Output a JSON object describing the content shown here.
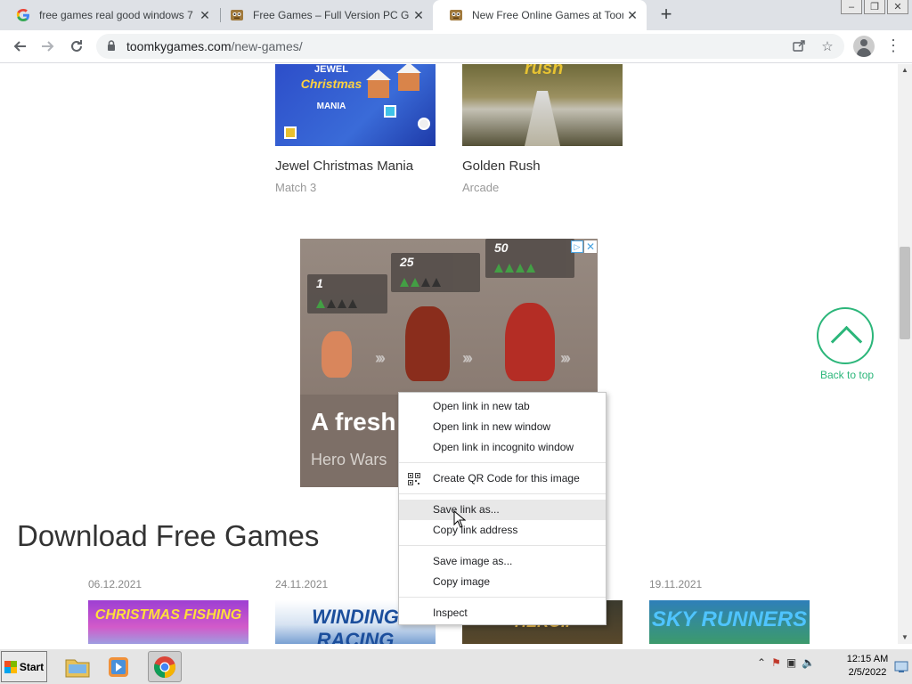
{
  "tabs": [
    {
      "title": "free games real good windows 7",
      "favicon": "google-icon",
      "active": false
    },
    {
      "title": "Free Games – Full Version PC Ga",
      "favicon": "toomky-icon",
      "active": false
    },
    {
      "title": "New Free Online Games at Toom",
      "favicon": "toomky-icon",
      "active": true
    }
  ],
  "address": {
    "domain": "toomkygames.com",
    "path": "/new-games/"
  },
  "games": [
    {
      "name": "Jewel Christmas Mania",
      "category": "Match 3",
      "thumb_text": [
        "JEWEL",
        "Christmas",
        "MANIA"
      ]
    },
    {
      "name": "Golden Rush",
      "category": "Arcade",
      "thumb_text": [
        "rush"
      ]
    }
  ],
  "ad": {
    "stages": [
      "1",
      "25",
      "50"
    ],
    "headline": "A fresh",
    "subtitle": "Hero Wars",
    "choices_icon": "adchoices-icon",
    "close_icon": "close-icon"
  },
  "back_to_top": "Back to top",
  "section_title": "Download Free Games",
  "downloads": [
    {
      "date": "06.12.2021",
      "thumb_text": "CHRISTMAS FISHING"
    },
    {
      "date": "24.11.2021",
      "thumb_text": "WINDING RACING"
    },
    {
      "date": "",
      "thumb_text": "HEROII"
    },
    {
      "date": "19.11.2021",
      "thumb_text": "SKY RUNNERS"
    }
  ],
  "context_menu": {
    "items": [
      "Open link in new tab",
      "Open link in new window",
      "Open link in incognito window",
      "Create QR Code for this image",
      "Save link as...",
      "Copy link address",
      "Save image as...",
      "Copy image",
      "Inspect"
    ],
    "highlighted": "Save link as..."
  },
  "taskbar": {
    "start_label": "Start",
    "time": "12:15 AM",
    "date": "2/5/2022"
  },
  "colors": {
    "accent_green": "#2cb67a",
    "tab_strip": "#dee1e6"
  }
}
